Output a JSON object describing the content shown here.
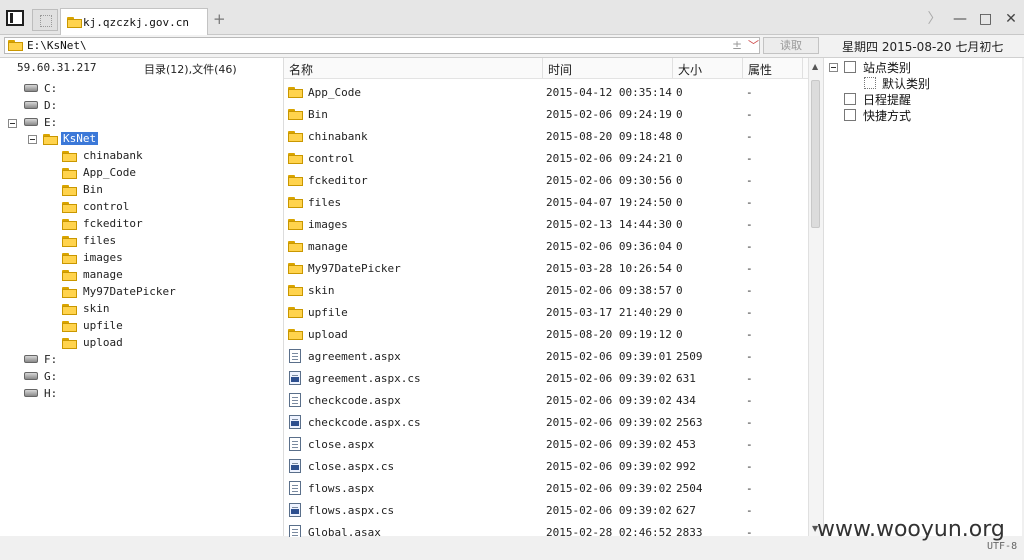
{
  "tab": {
    "title": "kj.qzczkj.gov.cn"
  },
  "address": {
    "path": "E:\\KsNet\\",
    "read_label": "读取",
    "plus": "±",
    "caret": "﹀"
  },
  "date": {
    "label": "星期四 2015-08-20 七月初七"
  },
  "left": {
    "ip": "59.60.31.217",
    "counts": "目录(12),文件(46)",
    "drives": [
      "C:",
      "D:",
      "E:",
      "F:",
      "G:",
      "H:"
    ],
    "selected_folder": "KsNet",
    "subfolders": [
      "chinabank",
      "App_Code",
      "Bin",
      "control",
      "fckeditor",
      "files",
      "images",
      "manage",
      "My97DatePicker",
      "skin",
      "upfile",
      "upload"
    ]
  },
  "list": {
    "headers": {
      "name": "名称",
      "time": "时间",
      "size": "大小",
      "attr": "属性"
    },
    "rows": [
      {
        "type": "folder",
        "name": "App_Code",
        "time": "2015-04-12 00:35:14",
        "size": "0",
        "attr": "-"
      },
      {
        "type": "folder",
        "name": "Bin",
        "time": "2015-02-06 09:24:19",
        "size": "0",
        "attr": "-"
      },
      {
        "type": "folder",
        "name": "chinabank",
        "time": "2015-08-20 09:18:48",
        "size": "0",
        "attr": "-"
      },
      {
        "type": "folder",
        "name": "control",
        "time": "2015-02-06 09:24:21",
        "size": "0",
        "attr": "-"
      },
      {
        "type": "folder",
        "name": "fckeditor",
        "time": "2015-02-06 09:30:56",
        "size": "0",
        "attr": "-"
      },
      {
        "type": "folder",
        "name": "files",
        "time": "2015-04-07 19:24:50",
        "size": "0",
        "attr": "-"
      },
      {
        "type": "folder",
        "name": "images",
        "time": "2015-02-13 14:44:30",
        "size": "0",
        "attr": "-"
      },
      {
        "type": "folder",
        "name": "manage",
        "time": "2015-02-06 09:36:04",
        "size": "0",
        "attr": "-"
      },
      {
        "type": "folder",
        "name": "My97DatePicker",
        "time": "2015-03-28 10:26:54",
        "size": "0",
        "attr": "-"
      },
      {
        "type": "folder",
        "name": "skin",
        "time": "2015-02-06 09:38:57",
        "size": "0",
        "attr": "-"
      },
      {
        "type": "folder",
        "name": "upfile",
        "time": "2015-03-17 21:40:29",
        "size": "0",
        "attr": "-"
      },
      {
        "type": "folder",
        "name": "upload",
        "time": "2015-08-20 09:19:12",
        "size": "0",
        "attr": "-"
      },
      {
        "type": "file",
        "name": "agreement.aspx",
        "time": "2015-02-06 09:39:01",
        "size": "2509",
        "attr": "-"
      },
      {
        "type": "cs",
        "name": "agreement.aspx.cs",
        "time": "2015-02-06 09:39:02",
        "size": "631",
        "attr": "-"
      },
      {
        "type": "file",
        "name": "checkcode.aspx",
        "time": "2015-02-06 09:39:02",
        "size": "434",
        "attr": "-"
      },
      {
        "type": "cs",
        "name": "checkcode.aspx.cs",
        "time": "2015-02-06 09:39:02",
        "size": "2563",
        "attr": "-"
      },
      {
        "type": "file",
        "name": "close.aspx",
        "time": "2015-02-06 09:39:02",
        "size": "453",
        "attr": "-"
      },
      {
        "type": "cs",
        "name": "close.aspx.cs",
        "time": "2015-02-06 09:39:02",
        "size": "992",
        "attr": "-"
      },
      {
        "type": "file",
        "name": "flows.aspx",
        "time": "2015-02-06 09:39:02",
        "size": "2504",
        "attr": "-"
      },
      {
        "type": "cs",
        "name": "flows.aspx.cs",
        "time": "2015-02-06 09:39:02",
        "size": "627",
        "attr": "-"
      },
      {
        "type": "file",
        "name": "Global.asax",
        "time": "2015-02-28 02:46:52",
        "size": "2833",
        "attr": "-"
      }
    ]
  },
  "right": {
    "site_category": "站点类别",
    "default_category": "默认类别",
    "schedule": "日程提醒",
    "shortcut": "快捷方式"
  },
  "status": {
    "watermark": "www.wooyun.org",
    "encoding": "UTF-8"
  }
}
